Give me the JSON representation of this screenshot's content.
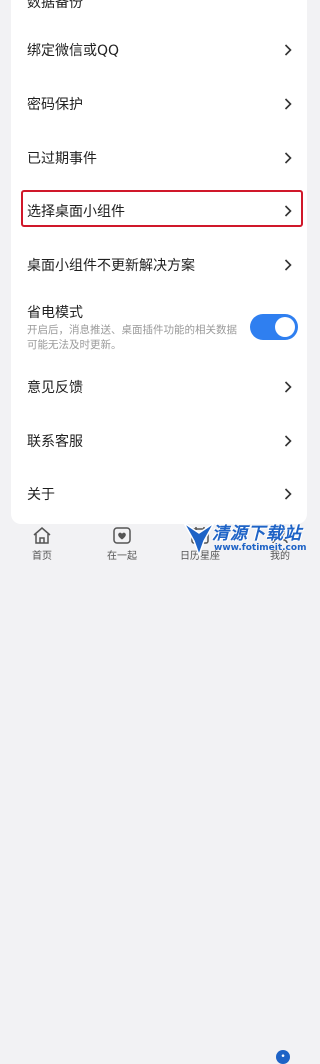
{
  "settings": {
    "partial_top": "数据备份",
    "rows": [
      {
        "label": "绑定微信或QQ"
      },
      {
        "label": "密码保护"
      },
      {
        "label": "已过期事件"
      },
      {
        "label": "选择桌面小组件"
      },
      {
        "label": "桌面小组件不更新解决方案"
      },
      {
        "label": "意见反馈"
      },
      {
        "label": "联系客服"
      },
      {
        "label": "关于"
      }
    ],
    "power_saving": {
      "title": "省电模式",
      "description": "开启后，消息推送、桌面插件功能的相关数据可能无法及时更新。",
      "enabled": true
    }
  },
  "tabbar": {
    "tabs": [
      {
        "label": "首页",
        "icon": "home-icon"
      },
      {
        "label": "在一起",
        "icon": "heart-icon"
      },
      {
        "label": "日历星座",
        "icon": "calendar-icon"
      },
      {
        "label": "我的",
        "icon": "profile-icon"
      }
    ]
  },
  "watermark": {
    "title": "清源下载站",
    "url": "www.fotimeit.com"
  },
  "colors": {
    "accent": "#2f7ff0",
    "highlight": "#d0182a"
  }
}
